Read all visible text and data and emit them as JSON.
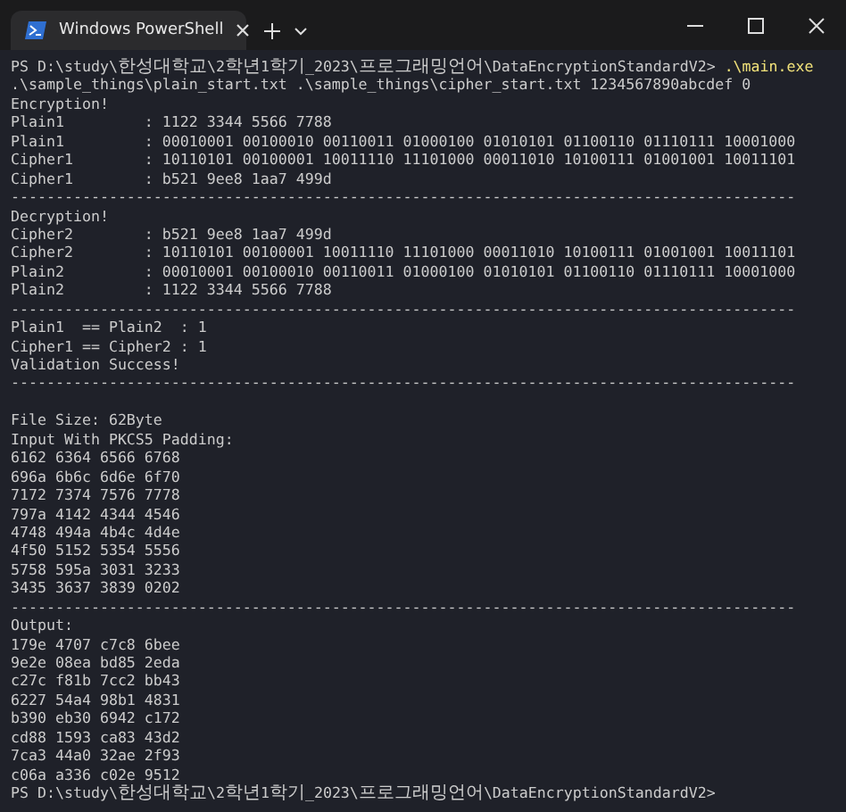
{
  "window": {
    "tab": {
      "title": "Windows PowerShell",
      "selected": true
    }
  },
  "terminal": {
    "lines": [
      {
        "kind": "prompt",
        "prompt": "PS D:\\study\\한성대학교\\2학년1학기_2023\\프로그래밍언어\\DataEncryptionStandardV2>",
        "command": ".\\main.exe"
      },
      {
        "kind": "text",
        "text": ".\\sample_things\\plain_start.txt .\\sample_things\\cipher_start.txt 1234567890abcdef 0"
      },
      {
        "kind": "text",
        "text": "Encryption!"
      },
      {
        "kind": "text",
        "text": "Plain1         : 1122 3344 5566 7788"
      },
      {
        "kind": "text",
        "text": "Plain1         : 00010001 00100010 00110011 01000100 01010101 01100110 01110111 10001000"
      },
      {
        "kind": "text",
        "text": "Cipher1        : 10110101 00100001 10011110 11101000 00011010 10100111 01001001 10011101"
      },
      {
        "kind": "text",
        "text": "Cipher1        : b521 9ee8 1aa7 499d"
      },
      {
        "kind": "text",
        "text": "----------------------------------------------------------------------------------------"
      },
      {
        "kind": "text",
        "text": "Decryption!"
      },
      {
        "kind": "text",
        "text": "Cipher2        : b521 9ee8 1aa7 499d"
      },
      {
        "kind": "text",
        "text": "Cipher2        : 10110101 00100001 10011110 11101000 00011010 10100111 01001001 10011101"
      },
      {
        "kind": "text",
        "text": "Plain2         : 00010001 00100010 00110011 01000100 01010101 01100110 01110111 10001000"
      },
      {
        "kind": "text",
        "text": "Plain2         : 1122 3344 5566 7788"
      },
      {
        "kind": "text",
        "text": "----------------------------------------------------------------------------------------"
      },
      {
        "kind": "text",
        "text": "Plain1  == Plain2  : 1"
      },
      {
        "kind": "text",
        "text": "Cipher1 == Cipher2 : 1"
      },
      {
        "kind": "text",
        "text": "Validation Success!"
      },
      {
        "kind": "text",
        "text": "----------------------------------------------------------------------------------------"
      },
      {
        "kind": "blank"
      },
      {
        "kind": "text",
        "text": "File Size: 62Byte"
      },
      {
        "kind": "text",
        "text": "Input With PKCS5 Padding:"
      },
      {
        "kind": "text",
        "text": "6162 6364 6566 6768"
      },
      {
        "kind": "text",
        "text": "696a 6b6c 6d6e 6f70"
      },
      {
        "kind": "text",
        "text": "7172 7374 7576 7778"
      },
      {
        "kind": "text",
        "text": "797a 4142 4344 4546"
      },
      {
        "kind": "text",
        "text": "4748 494a 4b4c 4d4e"
      },
      {
        "kind": "text",
        "text": "4f50 5152 5354 5556"
      },
      {
        "kind": "text",
        "text": "5758 595a 3031 3233"
      },
      {
        "kind": "text",
        "text": "3435 3637 3839 0202"
      },
      {
        "kind": "text",
        "text": "----------------------------------------------------------------------------------------"
      },
      {
        "kind": "text",
        "text": "Output:"
      },
      {
        "kind": "text",
        "text": "179e 4707 c7c8 6bee"
      },
      {
        "kind": "text",
        "text": "9e2e 08ea bd85 2eda"
      },
      {
        "kind": "text",
        "text": "c27c f81b 7cc2 bb43"
      },
      {
        "kind": "text",
        "text": "6227 54a4 98b1 4831"
      },
      {
        "kind": "text",
        "text": "b390 eb30 6942 c172"
      },
      {
        "kind": "text",
        "text": "cd88 1593 ca83 43d2"
      },
      {
        "kind": "text",
        "text": "7ca3 44a0 32ae 2f93"
      },
      {
        "kind": "text",
        "text": "c06a a336 c02e 9512"
      },
      {
        "kind": "prompt",
        "prompt": "PS D:\\study\\한성대학교\\2학년1학기_2023\\프로그래밍언어\\DataEncryptionStandardV2>"
      }
    ]
  }
}
